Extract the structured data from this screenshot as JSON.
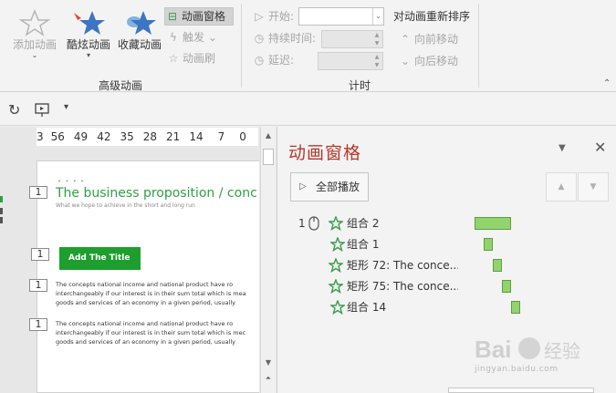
{
  "ribbon": {
    "advanced_group": {
      "add_animation": "添加动画",
      "cool_animation": "酷炫动画",
      "favorite_animation": "收藏动画",
      "animation_pane": "动画窗格",
      "trigger": "触发",
      "animation_painter": "动画刷",
      "group_label": "高级动画"
    },
    "timing_group": {
      "start_label": "开始:",
      "start_value": "",
      "duration_label": "持续时间:",
      "duration_value": "",
      "delay_label": "延迟:",
      "delay_value": "",
      "reorder_title": "对动画重新排序",
      "move_earlier": "向前移动",
      "move_later": "向后移动",
      "group_label": "计时"
    }
  },
  "ruler": {
    "ticks": [
      "3",
      "56",
      "49",
      "42",
      "35",
      "28",
      "21",
      "14",
      "7",
      "0"
    ]
  },
  "slide": {
    "dots": "• • • •",
    "title": "The business proposition / conc",
    "subtitle": "What we hope to achieve in the short and long run",
    "button_label": "Add The Title",
    "para1": [
      "The concepts national income and national product have ro",
      "interchangeably if our interest is in their sum total which is mea",
      "goods and services of an economy in a given period, usually"
    ],
    "para2": [
      "The concepts national income and national product have ro",
      "interchangeably if our interest is in their sum total which is mec",
      "goods and services of an economy in a given period, usually"
    ],
    "markers": [
      "1",
      "1",
      "1",
      "1"
    ]
  },
  "pane": {
    "title": "动画窗格",
    "play_all": "全部播放",
    "items": [
      {
        "index": "1",
        "name": "组合 2",
        "bar_start": 0.0,
        "bar_len": 1.0
      },
      {
        "index": "",
        "name": "组合 1",
        "bar_start": 0.26,
        "bar_len": 0.26
      },
      {
        "index": "",
        "name": "矩形 72: The conce...",
        "bar_start": 0.52,
        "bar_len": 0.26
      },
      {
        "index": "",
        "name": "矩形 75: The conce...",
        "bar_start": 0.78,
        "bar_len": 0.26
      },
      {
        "index": "",
        "name": "组合 14",
        "bar_start": 1.04,
        "bar_len": 0.26
      }
    ]
  },
  "watermark": {
    "text": "Bai 经验",
    "url": "jingyan.baidu.com"
  },
  "colors": {
    "title_green": "#2ea043",
    "button_green": "#1e9e2e",
    "pane_title": "#b5372a",
    "bar_fill": "#92d36e",
    "star_green": "#3a9c4a"
  }
}
